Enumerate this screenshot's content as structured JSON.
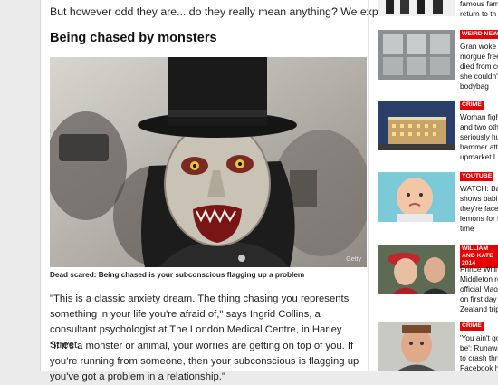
{
  "article": {
    "intro": "But however odd they are... do they really mean anything? We explain all below.",
    "heading": "Being chased by monsters",
    "image_credit": "Getty",
    "caption": "Dead scared: Being chased is your subconscious flagging up a problem",
    "paragraphs": [
      "\"This is a classic anxiety dream. The thing chasing you represents something in your life you're afraid of,\" says Ingrid Collins, a consultant psychologist at The London Medical Centre, in Harley Street.",
      "\"If it's a monster or animal, your worries are getting on top of you. If you're running from someone, then your subconscious is flagging up you've got a problem in a relationship.\""
    ]
  },
  "sidebar": {
    "stories": [
      {
        "tag": "",
        "text": "famous fami\nreturn to th"
      },
      {
        "tag": "WEIRD NEWS",
        "text": "Gran woke \nmorgue free\ndied from co\nshe couldn't\nbodybag"
      },
      {
        "tag": "CRIME",
        "text": "Woman figh\nand two oth\nseriously hu\nhammer atta\nupmarket L"
      },
      {
        "tag": "YOUTUBE",
        "text": "WATCH: Bab\nshows babie\nthey're face\nlemons for th\ntime"
      },
      {
        "tag": "WILLIAM AND KATE 2014",
        "text": "Prince Willi\nMiddleton re\nofficial Mao\non first day\nZealand trip"
      },
      {
        "tag": "CRIME",
        "text": "'You ain't go\nbe': Runawa\nto crash thro\nFacebook h"
      }
    ]
  },
  "colors": {
    "tag_red": "#e60000",
    "background": "#ebebeb"
  }
}
